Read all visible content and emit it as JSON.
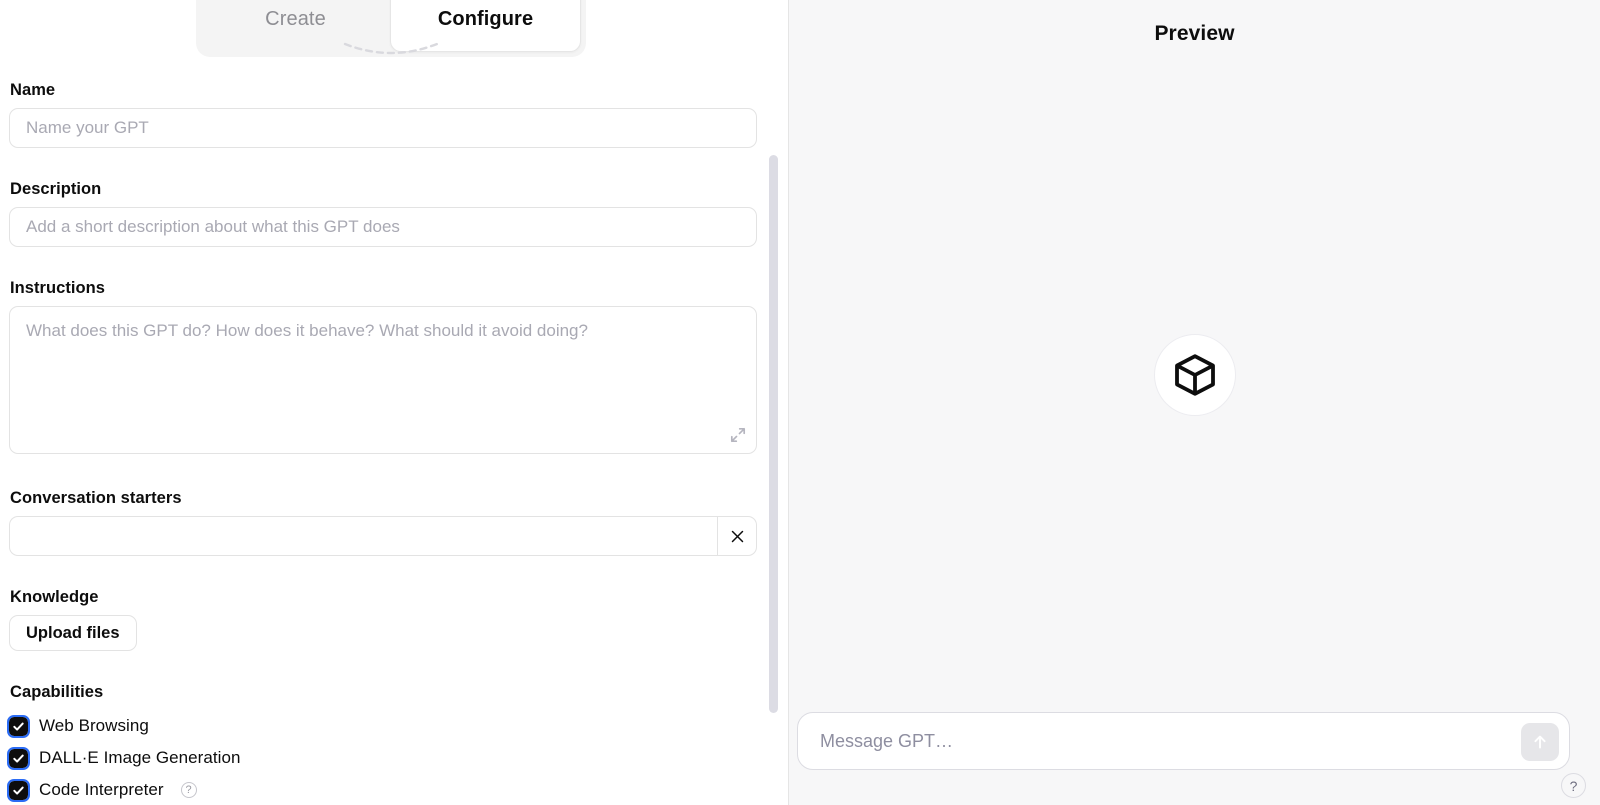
{
  "tabs": {
    "create_label": "Create",
    "configure_label": "Configure",
    "active": "Configure"
  },
  "form": {
    "name": {
      "label": "Name",
      "value": "",
      "placeholder": "Name your GPT"
    },
    "description": {
      "label": "Description",
      "value": "",
      "placeholder": "Add a short description about what this GPT does"
    },
    "instructions": {
      "label": "Instructions",
      "value": "",
      "placeholder": "What does this GPT do? How does it behave? What should it avoid doing?",
      "expand_icon": "expand-diagonal-icon"
    },
    "conversation_starters": {
      "label": "Conversation starters",
      "value": "",
      "placeholder": "",
      "remove_label": "✕",
      "remove_icon": "close-x-icon"
    },
    "knowledge": {
      "label": "Knowledge",
      "upload_label": "Upload files"
    },
    "capabilities": {
      "label": "Capabilities",
      "items": [
        {
          "label": "Web Browsing",
          "checked": true,
          "info": false
        },
        {
          "label": "DALL·E Image Generation",
          "checked": true,
          "info": false
        },
        {
          "label": "Code Interpreter",
          "checked": true,
          "info": true,
          "info_label": "?"
        }
      ]
    }
  },
  "preview": {
    "title": "Preview",
    "avatar_icon": "cube-box-icon",
    "composer": {
      "value": "",
      "placeholder": "Message GPT…",
      "send_icon": "arrow-up-icon"
    },
    "help_label": "?"
  },
  "colors": {
    "accent": "#2b6cf5",
    "checkbox_fill": "#0d0d0d",
    "pane_bg": "#f7f7f8",
    "tab_group_bg": "#f4f4f4",
    "border": "#e3e3e3",
    "scrollbar": "#dcdce4",
    "send_button_bg": "#e6e6e9"
  }
}
